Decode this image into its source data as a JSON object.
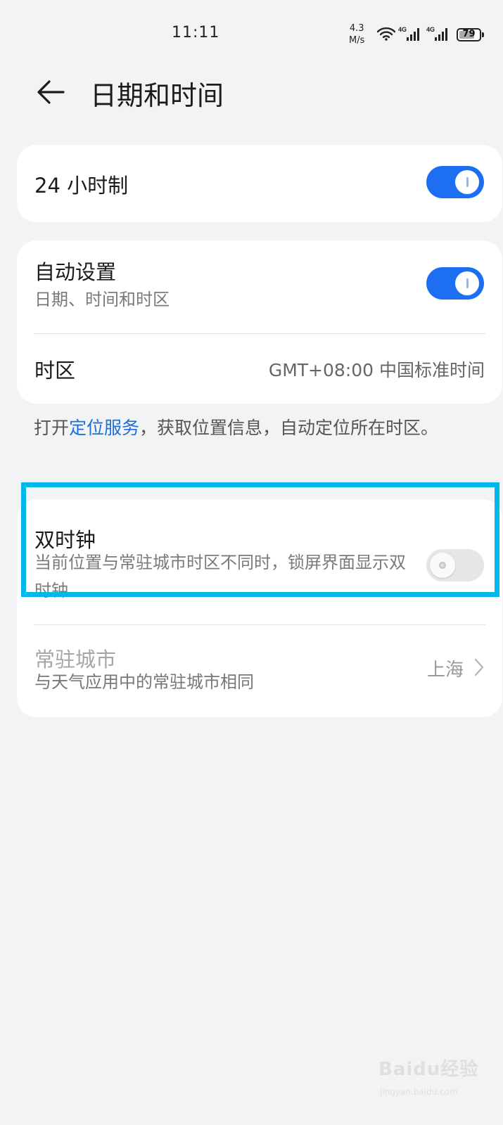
{
  "status_bar": {
    "time": "11:11",
    "net_speed_value": "4.3",
    "net_speed_unit": "M/s",
    "signal1_label": "4G",
    "signal2_label": "4G",
    "battery": "79",
    "battery_level": 0.79
  },
  "header": {
    "title": "日期和时间"
  },
  "settings": {
    "hour24": {
      "label": "24 小时制",
      "enabled": true
    },
    "auto": {
      "label": "自动设置",
      "sub": "日期、时间和时区",
      "enabled": true
    },
    "timezone": {
      "label": "时区",
      "value": "GMT+08:00 中国标准时间"
    }
  },
  "location_note": {
    "prefix": "打开",
    "link": "定位服务",
    "suffix": "，获取位置信息，自动定位所在时区。"
  },
  "dual_clock": {
    "label": "双时钟",
    "sub": "当前位置与常驻城市时区不同时，锁屏界面显示双时钟",
    "enabled": false
  },
  "home_city": {
    "label": "常驻城市",
    "sub": "与天气应用中的常驻城市相同",
    "value": "上海"
  },
  "watermark": {
    "brand": "Baidu经验",
    "url": "jingyan.baidu.com"
  },
  "colors": {
    "accent": "#1d6ff2",
    "link": "#1e6fd9",
    "highlight_border": "#00b8ea",
    "background": "#f1f3f5"
  }
}
